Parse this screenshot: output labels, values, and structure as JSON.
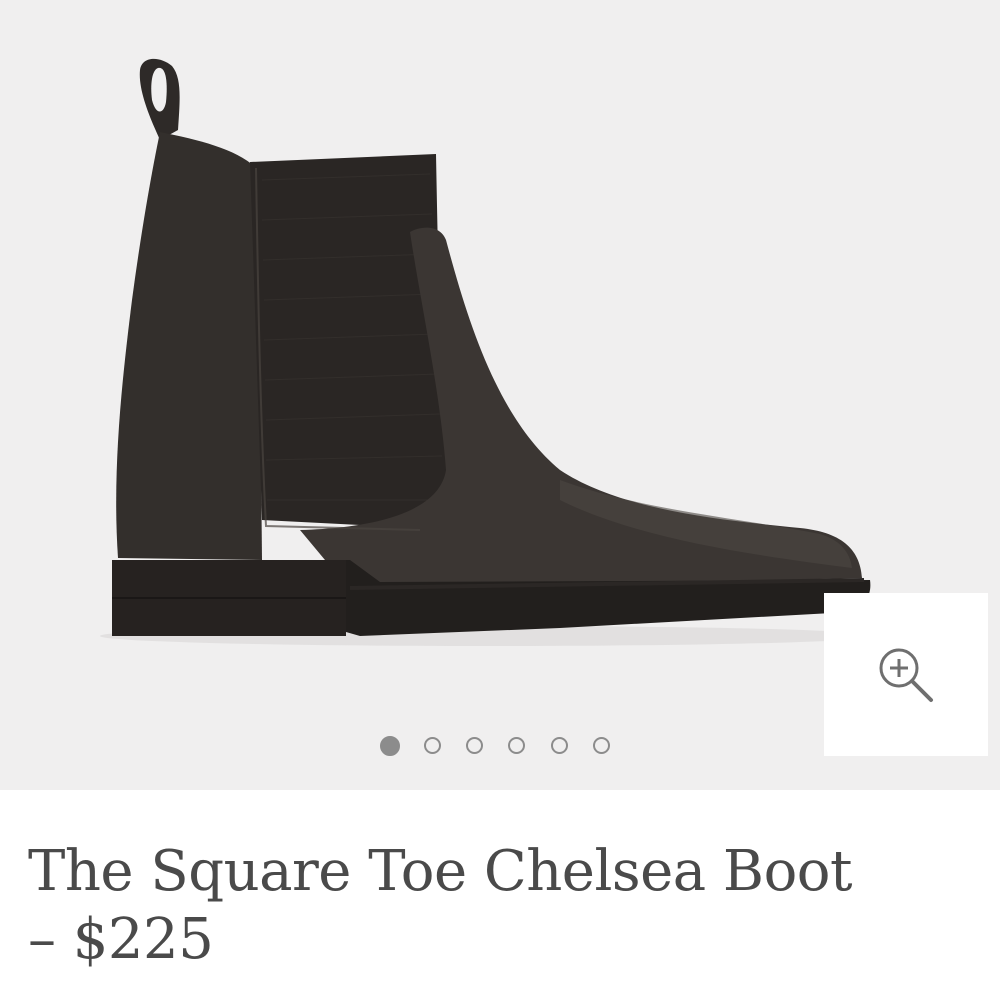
{
  "product": {
    "title_line1": "The Square Toe Chelsea Boot",
    "title_line2": "– $225"
  },
  "gallery": {
    "image_count": 6,
    "active_index": 0,
    "background_color": "#f0efef",
    "dot_color": "#8c8c8c"
  },
  "zoom": {
    "icon": "zoom-in-icon"
  }
}
